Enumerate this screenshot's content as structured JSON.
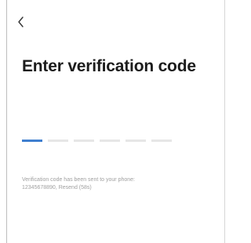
{
  "header": {
    "back_icon": "chevron-left-icon"
  },
  "title": "Enter verification code",
  "code_input": {
    "slots": 6,
    "active_index": 0,
    "active_color": "#3f7fcf",
    "inactive_color": "#e6e6e6"
  },
  "hint": {
    "line1": "Verification code has been sent to your phone:",
    "phone": "12345678890",
    "resend_label": "Resend (58s)"
  }
}
